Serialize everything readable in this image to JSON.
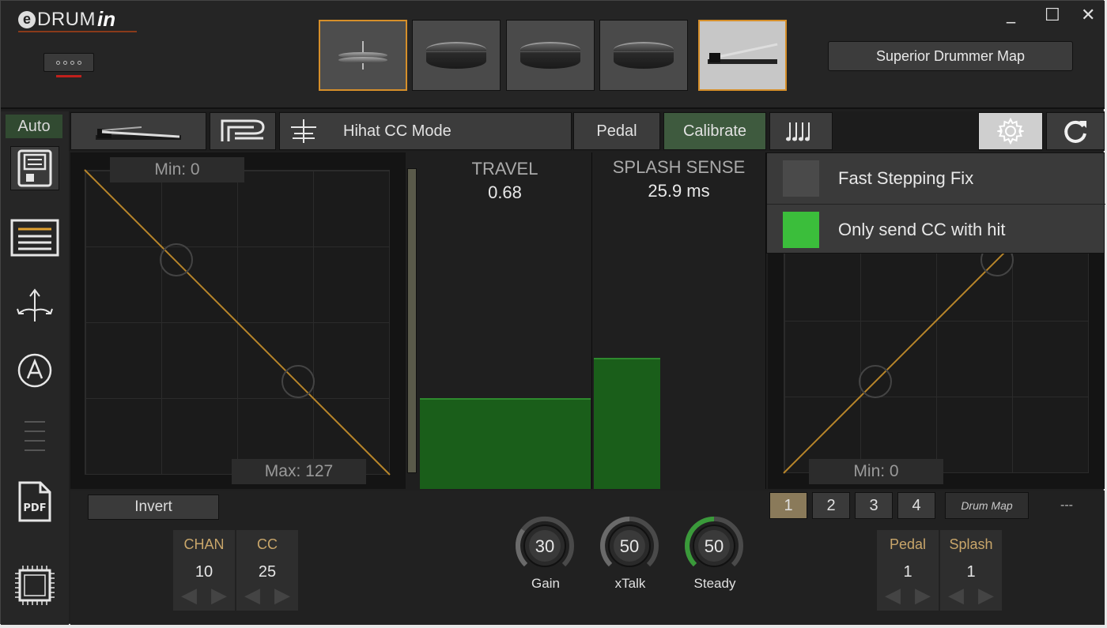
{
  "app": {
    "logo_drum": "DRUM",
    "logo_in": "in",
    "superior_map_label": "Superior Drummer Map",
    "window_controls": {
      "minimize": "_",
      "maximize": "☐",
      "close": "✕"
    }
  },
  "pads": [
    {
      "type": "cymbal-icon",
      "state": "selected"
    },
    {
      "type": "drum-icon",
      "state": "normal"
    },
    {
      "type": "drum-icon",
      "state": "normal"
    },
    {
      "type": "drum-icon",
      "state": "normal"
    },
    {
      "type": "hihat-pedal-icon",
      "state": "light"
    }
  ],
  "toolbar": {
    "mode_label": "Hihat CC Mode",
    "pedal_label": "Pedal",
    "calibrate_label": "Calibrate"
  },
  "sidebar": {
    "auto_label": "Auto",
    "icons": [
      "save-icon",
      "list-icon",
      "routing-icon",
      "auto-icon",
      "menu-lines-icon",
      "pdf-icon",
      "chip-icon"
    ],
    "pdf_text": "PDF"
  },
  "left_graph": {
    "min_label": "Min: 0",
    "max_label": "Max: 127"
  },
  "meters": {
    "travel": {
      "title": "TRAVEL",
      "value": "0.68",
      "level": 0.27
    },
    "splash": {
      "title": "SPLASH SENSE",
      "value": "25.9 ms",
      "level": 0.39
    }
  },
  "menu": {
    "items": [
      {
        "label": "Fast Stepping Fix",
        "checked": false
      },
      {
        "label": "Only send CC with hit",
        "checked": true
      }
    ]
  },
  "right_graph": {
    "min_label": "Min: 0"
  },
  "bottom": {
    "invert_label": "Invert",
    "chan": {
      "label": "CHAN",
      "value": "10"
    },
    "cc": {
      "label": "CC",
      "value": "25"
    },
    "knobs": [
      {
        "name": "Gain",
        "value": "30",
        "level": 0.3
      },
      {
        "name": "xTalk",
        "value": "50",
        "level": 0.5
      },
      {
        "name": "Steady",
        "value": "50",
        "level": 0.5
      }
    ],
    "slots": [
      "1",
      "2",
      "3",
      "4"
    ],
    "selected_slot": "1",
    "drum_map_label": "Drum Map",
    "dash": "---",
    "pedal": {
      "label": "Pedal",
      "value": "1"
    },
    "splash": {
      "label": "Splash",
      "value": "1"
    }
  },
  "colors": {
    "accent_orange": "#d68f2a",
    "meter_green": "#1a5e1a",
    "check_green": "#3bbe3b",
    "curve": "#b8862a"
  }
}
